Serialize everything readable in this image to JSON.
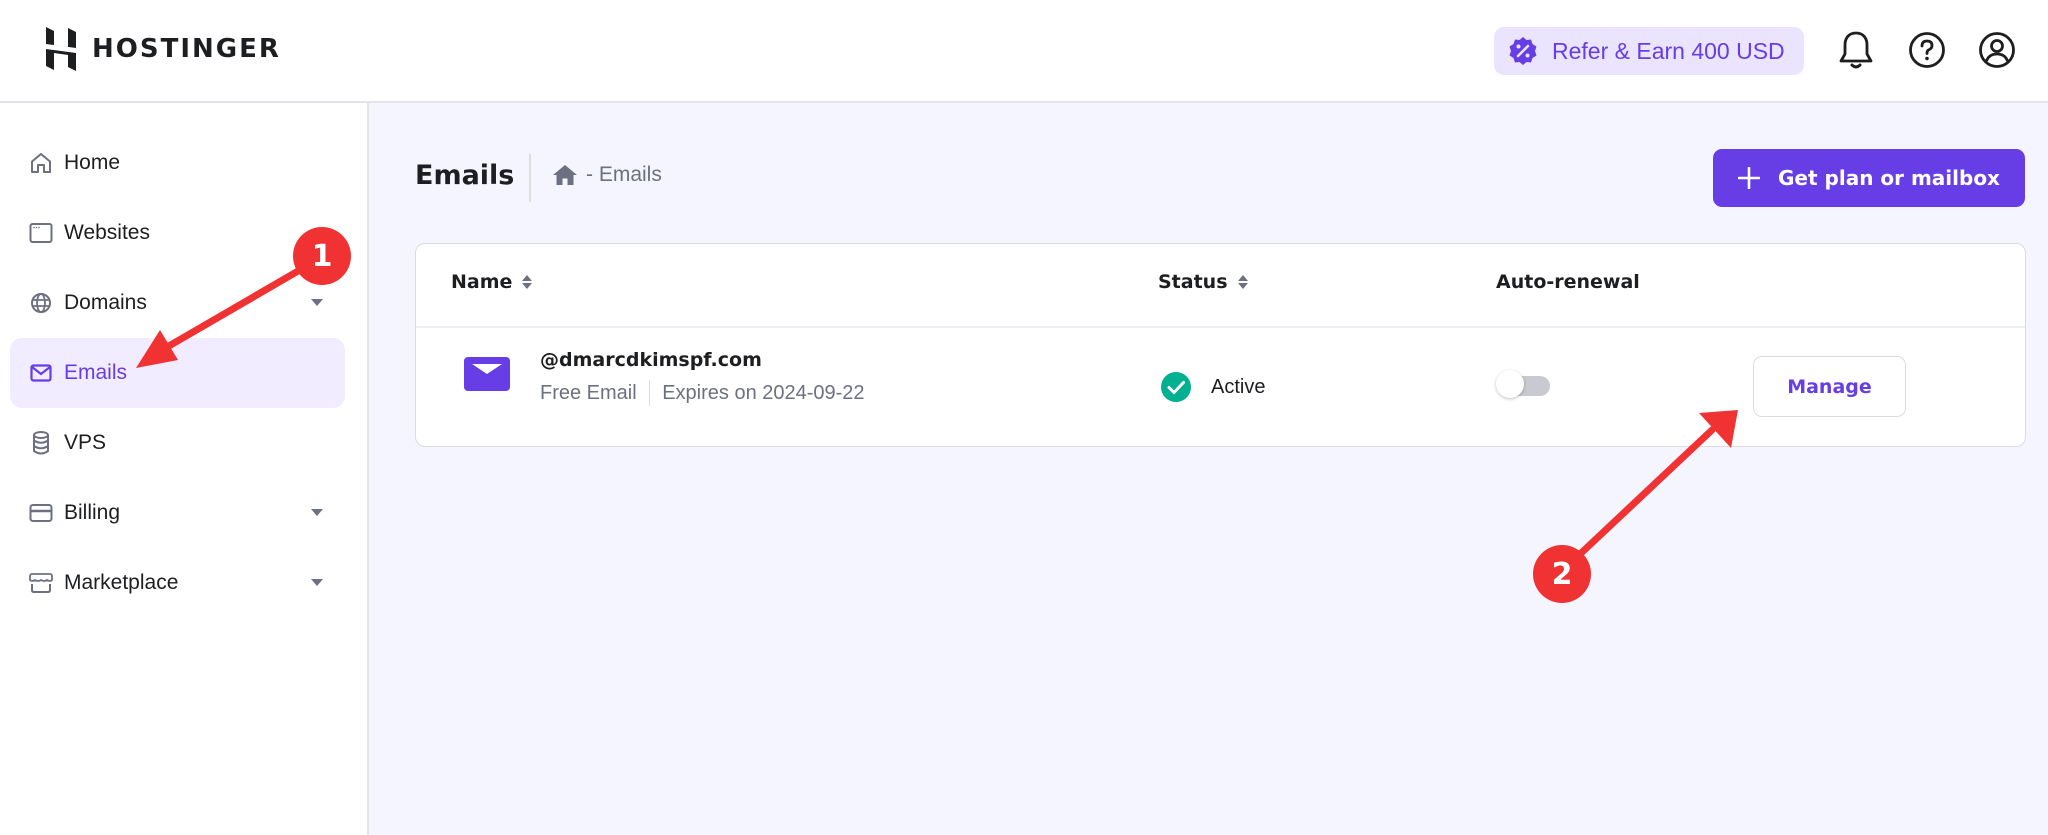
{
  "header": {
    "brand": "HOSTINGER",
    "refer_label": "Refer & Earn 400 USD",
    "icons": [
      "notification-bell-icon",
      "help-icon",
      "account-icon"
    ]
  },
  "sidebar": {
    "items": [
      {
        "label": "Home",
        "icon": "home-icon",
        "expandable": false,
        "active": false
      },
      {
        "label": "Websites",
        "icon": "browser-window-icon",
        "expandable": false,
        "active": false
      },
      {
        "label": "Domains",
        "icon": "globe-icon",
        "expandable": true,
        "active": false
      },
      {
        "label": "Emails",
        "icon": "envelope-icon",
        "expandable": false,
        "active": true
      },
      {
        "label": "VPS",
        "icon": "database-icon",
        "expandable": false,
        "active": false
      },
      {
        "label": "Billing",
        "icon": "credit-card-icon",
        "expandable": true,
        "active": false
      },
      {
        "label": "Marketplace",
        "icon": "store-icon",
        "expandable": true,
        "active": false
      }
    ]
  },
  "page": {
    "title": "Emails",
    "breadcrumb": "- Emails",
    "primary_button": "Get plan or mailbox"
  },
  "table": {
    "columns": [
      {
        "label": "Name",
        "sortable": true
      },
      {
        "label": "Status",
        "sortable": true
      },
      {
        "label": "Auto-renewal",
        "sortable": false
      }
    ],
    "rows": [
      {
        "domain": "@dmarcdkimspf.com",
        "plan": "Free Email",
        "expires": "Expires on 2024-09-22",
        "status": "Active",
        "auto_renewal": false,
        "action": "Manage"
      }
    ]
  },
  "annotations": [
    {
      "number": "1",
      "target": "sidebar-item-emails"
    },
    {
      "number": "2",
      "target": "manage-button"
    }
  ],
  "colors": {
    "brand": "#673DE6",
    "brand_light": "#EBE4FF",
    "status_active": "#00B090",
    "annotation": "#F03232"
  }
}
